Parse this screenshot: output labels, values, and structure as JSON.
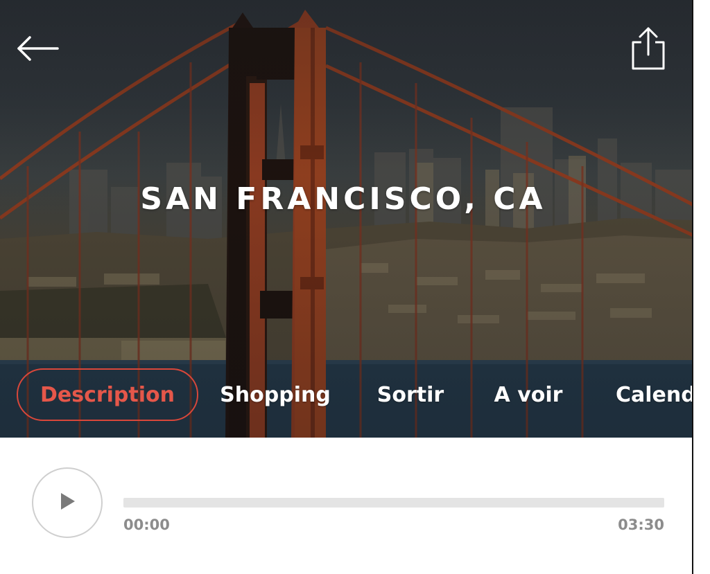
{
  "hero": {
    "title": "SAN FRANCISCO, CA",
    "background_image": "golden-gate-bridge-skyline",
    "back_icon": "arrow-left-icon",
    "share_icon": "share-icon"
  },
  "tabs": [
    {
      "label": "Description",
      "active": true
    },
    {
      "label": "Shopping",
      "active": false
    },
    {
      "label": "Sortir",
      "active": false
    },
    {
      "label": "A voir",
      "active": false
    },
    {
      "label": "Calend",
      "active": false
    }
  ],
  "player": {
    "play_icon": "play-icon",
    "current_time": "00:00",
    "total_time": "03:30",
    "progress": 0
  },
  "colors": {
    "accent": "#d9473a",
    "track": "#e4e4e4",
    "time_text": "#8c8c8c"
  }
}
